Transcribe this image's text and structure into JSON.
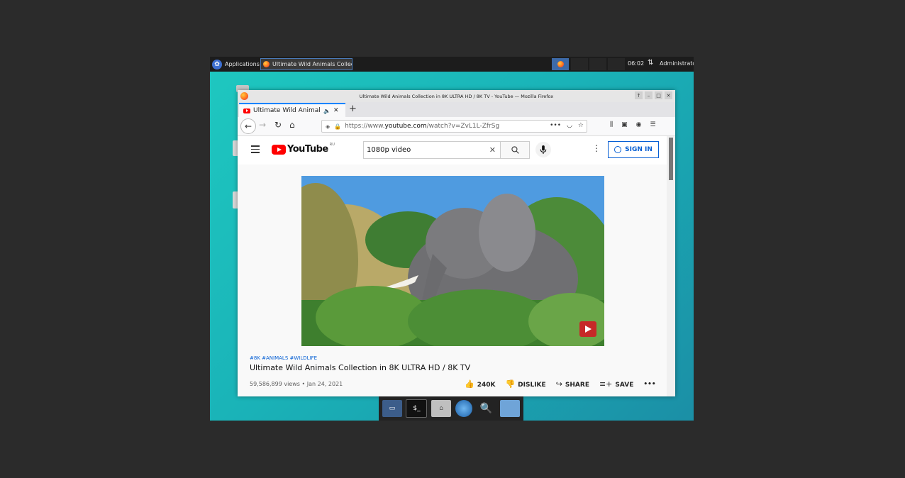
{
  "topbar": {
    "applications_label": "Applications",
    "task_label": "Ultimate Wild Animals Collecti…",
    "clock": "06:02",
    "user": "Administrator"
  },
  "window": {
    "title": "Ultimate Wild Animals Collection in 8K ULTRA HD / 8K TV - YouTube — Mozilla Firefox"
  },
  "tab": {
    "label": "Ultimate Wild Animals",
    "new_tab": "+"
  },
  "urlbar": {
    "prefix": "https://www.",
    "domain": "youtube.com",
    "path": "/watch?v=ZvL1L-ZfrSg",
    "more": "•••"
  },
  "youtube": {
    "logo_text": "YouTube",
    "country_code": "RU",
    "search_value": "1080p video",
    "signin_label": "SIGN IN",
    "video": {
      "tags": "#8K #ANIMALS #WILDLIFE",
      "title": "Ultimate Wild Animals Collection in 8K ULTRA HD / 8K TV",
      "views_date": "59,586,899 views • Jan 24, 2021",
      "like_count": "240K",
      "dislike_label": "DISLIKE",
      "share_label": "SHARE",
      "save_label": "SAVE",
      "more": "•••"
    }
  },
  "colors": {
    "accent": "#0a84ff",
    "yt_red": "#ff0000",
    "yt_blue": "#065fd4"
  }
}
